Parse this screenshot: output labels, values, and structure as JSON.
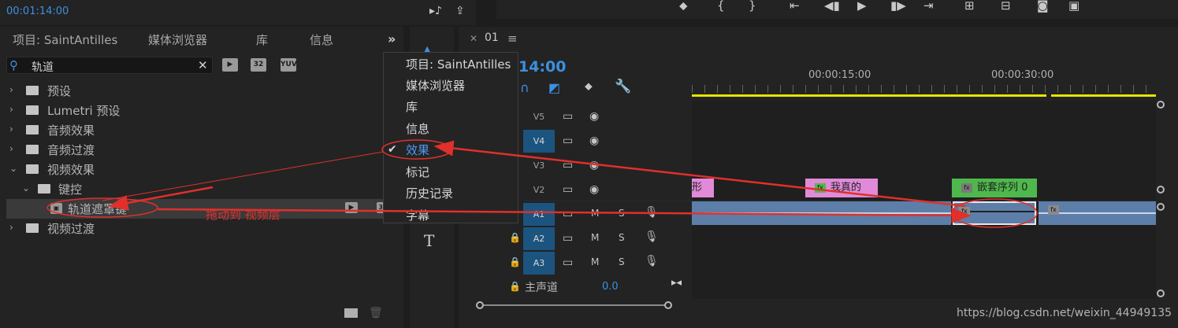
{
  "top": {
    "timecode": "00:01:14:00"
  },
  "panel": {
    "tabs": [
      "项目: SaintAntilles",
      "媒体浏览器",
      "库",
      "信息"
    ],
    "overflow_icon": "double-chevron-icon",
    "search_value": "轨道",
    "tree": [
      {
        "label": "预设",
        "depth": 0
      },
      {
        "label": "Lumetri 预设",
        "depth": 0
      },
      {
        "label": "音频效果",
        "depth": 0
      },
      {
        "label": "音频过渡",
        "depth": 0
      },
      {
        "label": "视频效果",
        "depth": 0,
        "expanded": true
      },
      {
        "label": "键控",
        "depth": 1,
        "expanded": true
      },
      {
        "label": "轨道遮罩键",
        "depth": 2,
        "selected": true
      },
      {
        "label": "视频过渡",
        "depth": 0
      }
    ],
    "annotation": "拖动到 视频层"
  },
  "menu": {
    "items": [
      "项目: SaintAntilles",
      "媒体浏览器",
      "库",
      "信息",
      "效果",
      "标记",
      "历史记录",
      "字幕"
    ],
    "checked": "效果"
  },
  "timeline": {
    "sequence_name": "01",
    "timecode": "14:00",
    "ruler": [
      "00:00:15:00",
      "00:00:30:00"
    ],
    "tracks": [
      "V5",
      "V4",
      "V3",
      "V2",
      "A1",
      "A2",
      "A3"
    ],
    "track_buttons": [
      "M",
      "S"
    ],
    "clips": [
      "形",
      "我真的",
      "嵌套序列 0"
    ],
    "fx_label": "fx",
    "master_label": "主声道",
    "master_value": "0.0"
  },
  "colors": {
    "accent_blue": "#3d8fe0",
    "workbar_yellow": "#e5e500",
    "clip_pink": "#e08ad8",
    "clip_green": "#4fb84c",
    "annotation_red": "#e0302b"
  },
  "watermark": "https://blog.csdn.net/weixin_44949135"
}
